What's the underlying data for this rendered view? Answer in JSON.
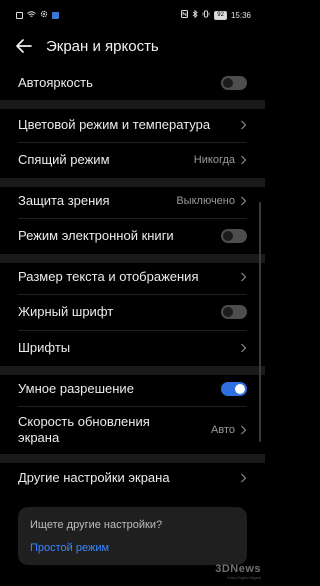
{
  "status_bar": {
    "time": "15:36",
    "battery": "92"
  },
  "header": {
    "title": "Экран и яркость"
  },
  "settings": {
    "auto_brightness": {
      "label": "Автояркость",
      "enabled": false
    },
    "color_mode": {
      "label": "Цветовой режим и температура"
    },
    "sleep_mode": {
      "label": "Спящий режим",
      "value": "Никогда"
    },
    "eye_comfort": {
      "label": "Защита зрения",
      "value": "Выключено"
    },
    "ebook_mode": {
      "label": "Режим электронной книги",
      "enabled": false
    },
    "text_display_size": {
      "label": "Размер текста и отображения"
    },
    "bold_font": {
      "label": "Жирный шрифт",
      "enabled": false
    },
    "fonts": {
      "label": "Шрифты"
    },
    "smart_resolution": {
      "label": "Умное разрешение",
      "enabled": true
    },
    "refresh_rate": {
      "label_line1": "Скорость обновления",
      "label_line2": "экрана",
      "value": "Авто"
    },
    "other_display": {
      "label": "Другие настройки экрана"
    }
  },
  "suggestion_card": {
    "question": "Ищете другие настройки?",
    "link": "Простой режим"
  },
  "watermark": {
    "brand": "3DNews",
    "tagline": "Daily Digital Digest"
  },
  "colors": {
    "accent": "#2f6fe0",
    "link": "#3a86ff",
    "background": "#000000",
    "separator": "#1a1a1a"
  }
}
